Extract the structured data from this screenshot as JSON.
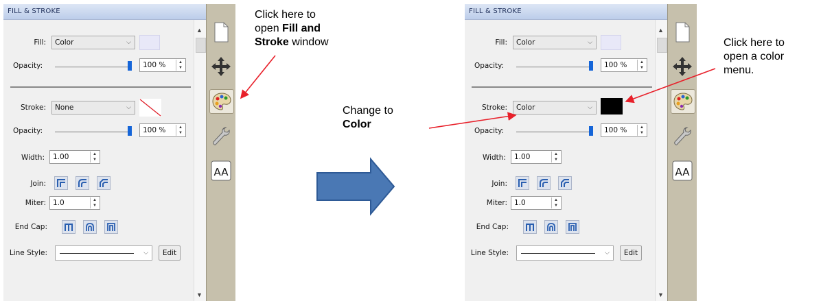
{
  "panels": {
    "left": {
      "title": "FILL & STROKE",
      "fill": {
        "label": "Fill:",
        "value": "Color",
        "swatch": "#e8e8f8"
      },
      "fill_opacity": {
        "label": "Opacity:",
        "value": "100 %",
        "level_percent": 100
      },
      "stroke": {
        "label": "Stroke:",
        "value": "None",
        "swatch": "none"
      },
      "stroke_opacity": {
        "label": "Opacity:",
        "value": "100 %",
        "level_percent": 100
      },
      "width": {
        "label": "Width:",
        "value": "1.00"
      },
      "join": {
        "label": "Join:"
      },
      "miter": {
        "label": "Miter:",
        "value": "1.0"
      },
      "endcap": {
        "label": "End Cap:"
      },
      "linestyle": {
        "label": "Line Style:",
        "edit": "Edit"
      }
    },
    "right": {
      "title": "FILL & STROKE",
      "fill": {
        "label": "Fill:",
        "value": "Color",
        "swatch": "#e8e8f8"
      },
      "fill_opacity": {
        "label": "Opacity:",
        "value": "100 %",
        "level_percent": 100
      },
      "stroke": {
        "label": "Stroke:",
        "value": "Color",
        "swatch": "#000000"
      },
      "stroke_opacity": {
        "label": "Opacity:",
        "value": "100 %",
        "level_percent": 100
      },
      "width": {
        "label": "Width:",
        "value": "1.00"
      },
      "join": {
        "label": "Join:"
      },
      "miter": {
        "label": "Miter:",
        "value": "1.0"
      },
      "endcap": {
        "label": "End Cap:"
      },
      "linestyle": {
        "label": "Line Style:",
        "edit": "Edit"
      }
    }
  },
  "tabs": [
    "page-icon",
    "move-icon",
    "palette-icon",
    "wrench-icon",
    "text-icon"
  ],
  "tab_text_glyph": "AA",
  "annotations": {
    "open_window": {
      "l1": "Click here to",
      "l2a": "open ",
      "l2b": "Fill and",
      "l3a": "Stroke",
      "l3b": " window"
    },
    "change_to": {
      "l1": "Change to",
      "l2": "Color"
    },
    "color_menu": {
      "l1": "Click here to",
      "l2": "open a color",
      "l3": "menu."
    }
  },
  "colors": {
    "arrow": "#4a78b4",
    "callout": "#e8202a",
    "slider": "#1565d8"
  }
}
